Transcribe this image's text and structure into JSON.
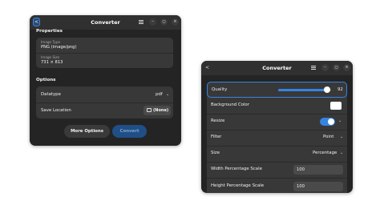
{
  "left_window": {
    "title": "Converter",
    "back_label": "<",
    "minimize_label": "–",
    "maximize_label": "◻",
    "close_label": "×",
    "properties_heading": "Properties",
    "image_type_label": "Image Type",
    "image_type_value": "PNG (image/png)",
    "image_size_label": "Image Size",
    "image_size_value": "731 × 813",
    "options_heading": "Options",
    "datatype_label": "Datatype",
    "datatype_value": "pdf",
    "save_location_label": "Save Location",
    "save_location_value": "(None)",
    "more_options_label": "More Options",
    "convert_label": "Convert"
  },
  "right_window": {
    "title": "Converter",
    "back_label": "<",
    "minimize_label": "–",
    "maximize_label": "◻",
    "close_label": "×",
    "quality_label": "Quality",
    "quality_value": "92",
    "quality_fraction": 0.92,
    "background_color_label": "Background Color",
    "background_color_value": "#ffffff",
    "resize_label": "Resize",
    "resize_enabled": true,
    "filter_label": "Filter",
    "filter_value": "Point",
    "size_label": "Size",
    "size_value": "Percentage",
    "width_scale_label": "Width Percentage Scale",
    "width_scale_value": "100",
    "height_scale_label": "Height Percentage Scale",
    "height_scale_value": "100"
  },
  "colors": {
    "window_bg": "#242424",
    "card_bg": "#383838",
    "accent": "#3584e4"
  }
}
